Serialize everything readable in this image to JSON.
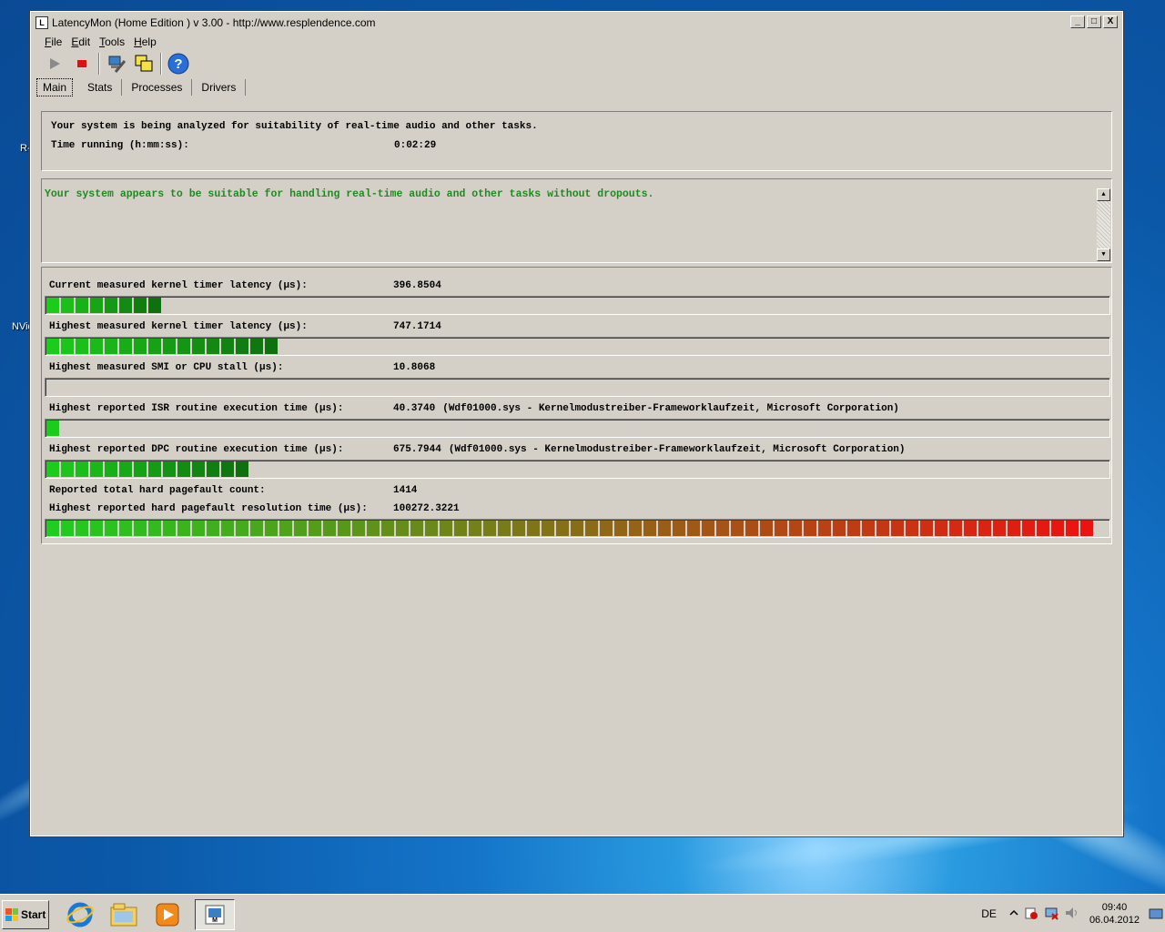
{
  "desktop": {
    "labels": [
      "R-",
      "NVid"
    ]
  },
  "window": {
    "title": "LatencyMon (Home Edition )  v 3.00 - http://www.resplendence.com",
    "buttons": {
      "minimize": "_",
      "maximize": "□",
      "close": "X"
    }
  },
  "menu": [
    {
      "key": "F",
      "rest": "ile"
    },
    {
      "key": "E",
      "rest": "dit"
    },
    {
      "key": "T",
      "rest": "ools"
    },
    {
      "key": "H",
      "rest": "elp"
    }
  ],
  "toolbar": {
    "icons": [
      "play-icon",
      "stop-icon",
      "tools-icon",
      "windows-icon",
      "help-icon"
    ]
  },
  "tabs": [
    "Main",
    "Stats",
    "Processes",
    "Drivers"
  ],
  "analysis": {
    "line1": "Your system is being analyzed for suitability of real-time audio and other tasks.",
    "time_label": "Time running (h:mm:ss):",
    "time_value": "0:02:29"
  },
  "result": {
    "message": "Your system appears to be suitable for handling real-time audio and other tasks without dropouts."
  },
  "metrics": [
    {
      "label": "Current measured kernel timer latency (µs):",
      "value": "396.8504",
      "extra": "",
      "bar": 0.107
    },
    {
      "label": "Highest measured kernel timer latency (µs):",
      "value": "747.1714",
      "extra": "",
      "bar": 0.218
    },
    {
      "label": "Highest measured SMI or CPU stall (µs):",
      "value": "10.8068",
      "extra": "",
      "bar": 0
    },
    {
      "label": "Highest reported ISR routine execution time (µs):",
      "value": "40.3740",
      "extra": "(Wdf01000.sys - Kernelmodustreiber-Frameworklaufzeit, Microsoft Corporation)",
      "bar": 0.012
    },
    {
      "label": "Highest reported DPC routine execution time (µs):",
      "value": "675.7944",
      "extra": "(Wdf01000.sys - Kernelmodustreiber-Frameworklaufzeit, Microsoft Corporation)",
      "bar": 0.19
    },
    {
      "label": "Reported total hard pagefault count:",
      "value": "1414",
      "extra": ""
    },
    {
      "label": "Highest reported hard pagefault resolution time (µs):",
      "value": "100272.3221",
      "extra": "",
      "bar": 1.0
    }
  ],
  "colors": {
    "green": "#1fcc1f",
    "red": "#ee1111",
    "result_text": "#1f8a1f"
  },
  "taskbar": {
    "start_label": "Start",
    "apps": [
      "internet-explorer-icon",
      "file-explorer-icon",
      "media-player-icon",
      "latencymon-taskbar-icon"
    ],
    "language": "DE",
    "time": "09:40",
    "date": "06.04.2012"
  }
}
